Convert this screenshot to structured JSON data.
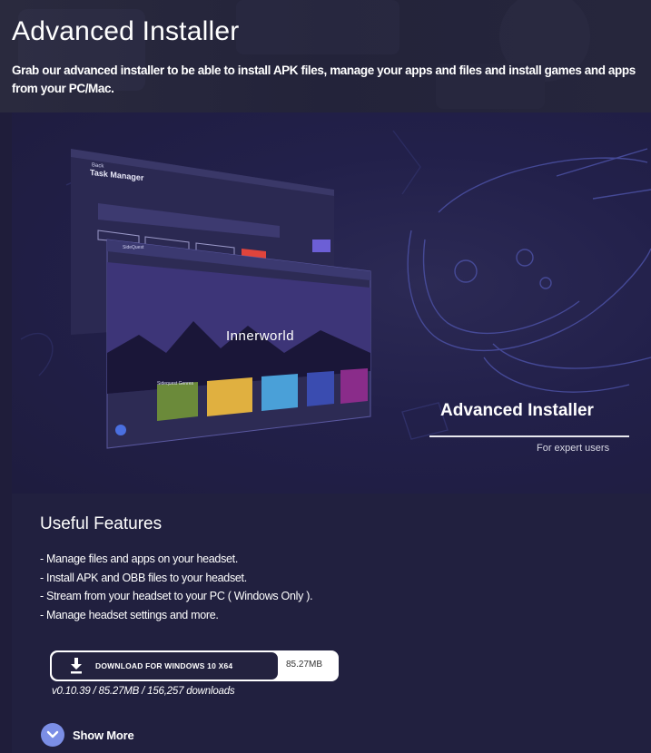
{
  "header": {
    "title": "Advanced Installer",
    "subtitle": "Grab our advanced installer to be able to install APK files, manage your apps and files and install games and apps from your PC/Mac."
  },
  "hero": {
    "title": "Advanced Installer",
    "tagline": "For expert users",
    "screenshot": {
      "back_screen_title": "Task Manager",
      "back_screen_back": "Back",
      "front_screen_app": "SideQuest",
      "banner_text": "Innerworld",
      "section_label": "Sidequest Genres"
    }
  },
  "features": {
    "title": "Useful Features",
    "items": [
      "- Manage files and apps on your headset.",
      "- Install APK and OBB files to your headset.",
      "- Stream from your headset to your PC ( Windows Only ).",
      "- Manage headset settings and more."
    ]
  },
  "download": {
    "label": "DOWNLOAD FOR WINDOWS 10 X64",
    "size": "85.27MB",
    "version_info": "v0.10.39 / 85.27MB / 156,257 downloads"
  },
  "show_more": {
    "label": "Show More"
  },
  "colors": {
    "page_bg": "#1f1d3a",
    "panel_bg": "#21203f",
    "accent": "#7b8ee6",
    "highlight_red": "#e0443c"
  },
  "icons": {
    "download": "download-icon",
    "show_more": "chevron-down-icon",
    "headset": "vr-headset-illustration"
  }
}
